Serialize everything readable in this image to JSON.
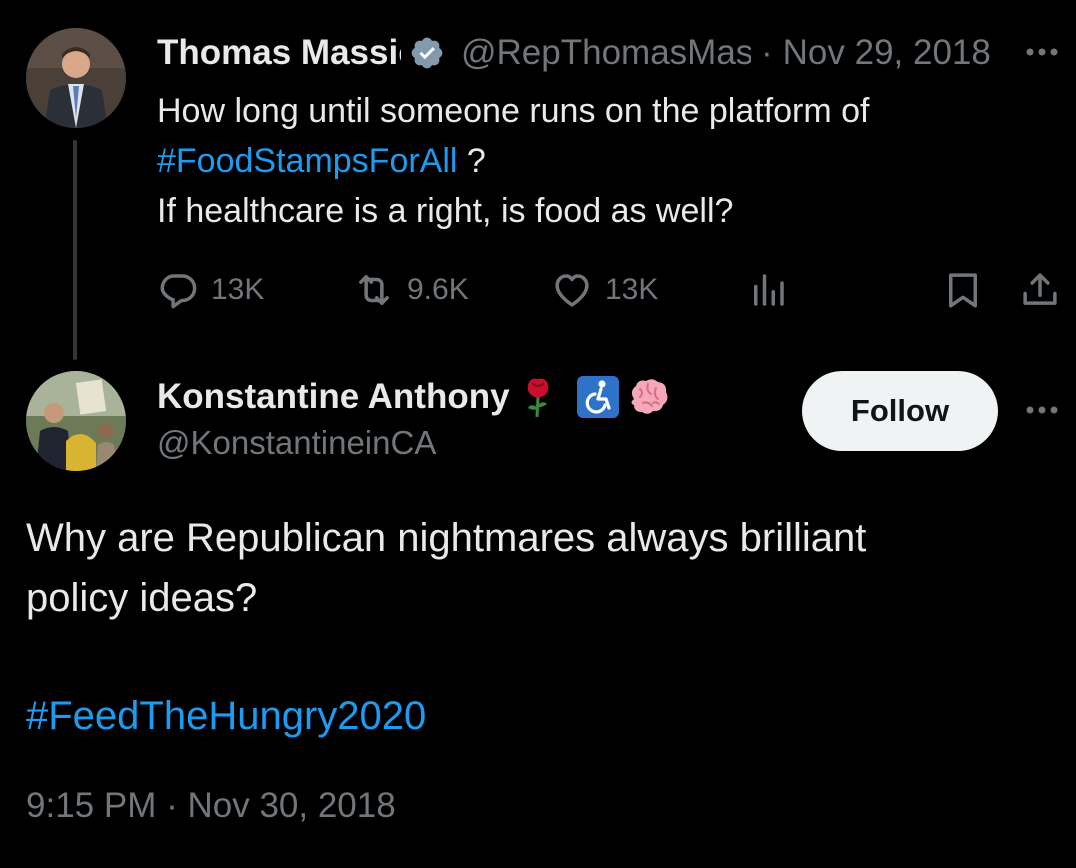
{
  "parent_tweet": {
    "author_name": "Thomas Massie",
    "author_handle": "@RepThomasMassie",
    "separator": "·",
    "date": "Nov 29, 2018",
    "text_line1": "How long until someone runs on the platform of",
    "hashtag": "#FoodStampsForAll",
    "text_after_hashtag": " ?",
    "text_line3": "If healthcare is a right, is food as well?",
    "stats": {
      "replies": "13K",
      "retweets": "9.6K",
      "likes": "13K"
    }
  },
  "main_tweet": {
    "author_name": "Konstantine Anthony",
    "author_handle": "@KonstantineinCA",
    "follow_label": "Follow",
    "text_line1": "Why are Republican nightmares always brilliant",
    "text_line2": "policy ideas?",
    "hashtag": "#FeedTheHungry2020",
    "time": "9:15 PM",
    "separator": "·",
    "date": "Nov 30, 2018"
  },
  "colors": {
    "background": "#000000",
    "primary_text": "#e7e9ea",
    "secondary_text": "#71767b",
    "link": "#1d9bf0",
    "verified_badge": "#829aab",
    "follow_button_bg": "#eff3f4"
  },
  "icons": {
    "parent_verified": "verified-badge-icon",
    "parent_more": "more-options-icon",
    "reply": "reply-icon",
    "retweet": "retweet-icon",
    "like": "heart-icon",
    "views": "views-icon",
    "bookmark": "bookmark-icon",
    "share": "share-icon",
    "name_emojis": [
      "rose-emoji-icon",
      "wheelchair-emoji-icon",
      "brain-emoji-icon"
    ],
    "main_more": "more-options-icon"
  }
}
